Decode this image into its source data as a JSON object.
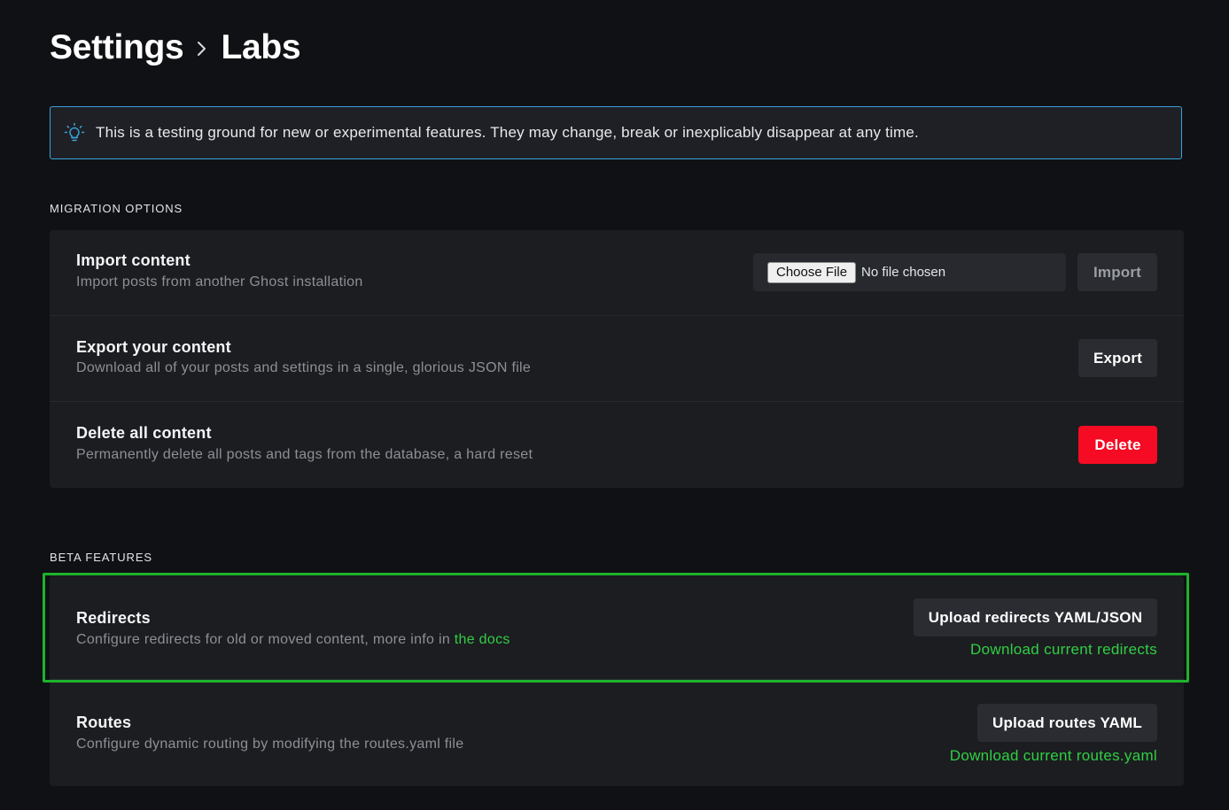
{
  "breadcrumb": {
    "parent": "Settings",
    "current": "Labs"
  },
  "notice": {
    "icon": "lightbulb-icon",
    "text": "This is a testing ground for new or experimental features. They may change, break or inexplicably disappear at any time."
  },
  "migration": {
    "heading": "MIGRATION OPTIONS",
    "import": {
      "title": "Import content",
      "description": "Import posts from another Ghost installation",
      "choose_file_label": "Choose File",
      "file_status": "No file chosen",
      "button_label": "Import"
    },
    "export": {
      "title": "Export your content",
      "description": "Download all of your posts and settings in a single, glorious JSON file",
      "button_label": "Export"
    },
    "delete": {
      "title": "Delete all content",
      "description": "Permanently delete all posts and tags from the database, a hard reset",
      "button_label": "Delete"
    }
  },
  "beta": {
    "heading": "BETA FEATURES",
    "redirects": {
      "title": "Redirects",
      "description": "Configure redirects for old or moved content, more info in ",
      "docs_link": "the docs",
      "upload_label": "Upload redirects YAML/JSON",
      "download_label": "Download current redirects"
    },
    "routes": {
      "title": "Routes",
      "description": "Configure dynamic routing by modifying the routes.yaml file",
      "upload_label": "Upload routes YAML",
      "download_label": "Download current routes.yaml"
    }
  },
  "colors": {
    "background": "#101114",
    "card": "#1c1d21",
    "accent_green": "#30cf43",
    "danger_red": "#f50b23",
    "notice_border": "#3aa3dc",
    "highlight_border": "#1db32b"
  }
}
